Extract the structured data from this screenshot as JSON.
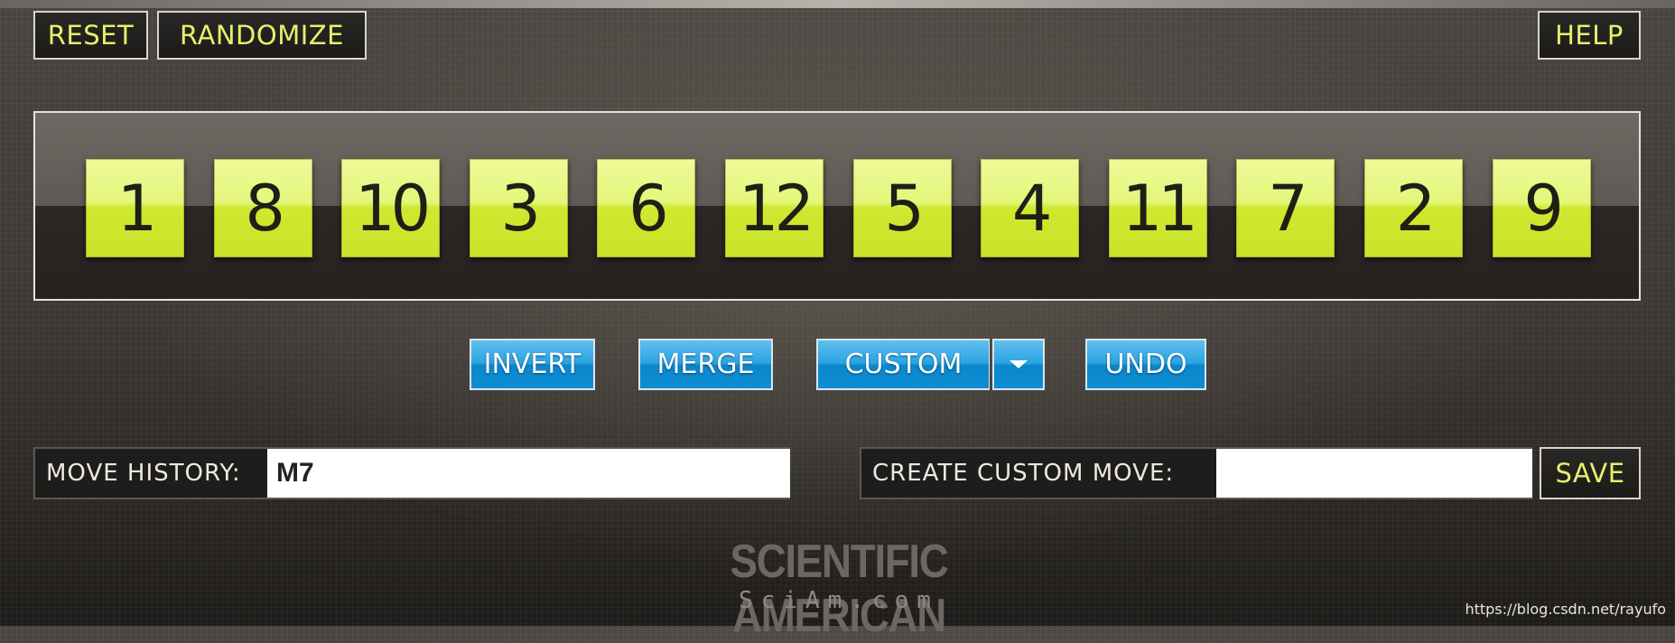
{
  "toolbar": {
    "reset_label": "RESET",
    "randomize_label": "RANDOMIZE",
    "help_label": "HELP"
  },
  "tiles": [
    "1",
    "8",
    "10",
    "3",
    "6",
    "12",
    "5",
    "4",
    "11",
    "7",
    "2",
    "9"
  ],
  "actions": {
    "invert_label": "INVERT",
    "merge_label": "MERGE",
    "custom_label": "CUSTOM",
    "undo_label": "UNDO"
  },
  "history": {
    "label": "MOVE HISTORY:",
    "value": "M7"
  },
  "custom_move": {
    "label": "CREATE CUSTOM MOVE:",
    "value": "",
    "save_label": "SAVE"
  },
  "brand": {
    "name": "SCIENTIFIC AMERICAN",
    "site": "SciAm.com"
  },
  "watermark": "https://blog.csdn.net/rayufo",
  "colors": {
    "tile": "#d6ee3a",
    "button_accent": "#e2f26a",
    "action_blue": "#1894d8"
  },
  "icons": {
    "custom_dropdown": "chevron-down-icon"
  }
}
